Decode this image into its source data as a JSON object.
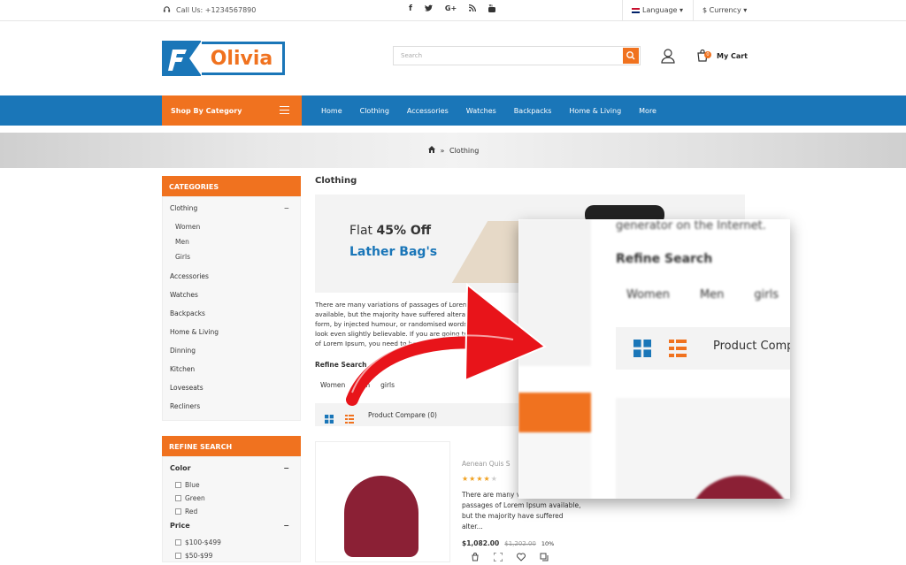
{
  "topbar": {
    "call": "Call Us: +1234567890",
    "language": "Language",
    "currency": "$ Currency",
    "social_icons": [
      "facebook-icon",
      "twitter-icon",
      "google-plus-icon",
      "rss-icon",
      "youtube-icon"
    ]
  },
  "header": {
    "logo_text": "Olivia",
    "search_placeholder": "Search",
    "cart_label": "My Cart",
    "cart_count": "0"
  },
  "nav": {
    "category_label": "Shop By Category",
    "items": [
      "Home",
      "Clothing",
      "Accessories",
      "Watches",
      "Backpacks",
      "Home & Living",
      "More"
    ]
  },
  "breadcrumb": {
    "current": "Clothing",
    "sep": "»"
  },
  "sidebar": {
    "categories_title": "CATEGORIES",
    "categories": [
      {
        "label": "Clothing",
        "toggle": "−"
      },
      {
        "label": "Accessories"
      },
      {
        "label": "Watches"
      },
      {
        "label": "Backpacks"
      },
      {
        "label": "Home & Living"
      },
      {
        "label": "Dinning"
      },
      {
        "label": "Kitchen"
      },
      {
        "label": "Loveseats"
      },
      {
        "label": "Recliners"
      }
    ],
    "subcategories": [
      "Women",
      "Men",
      "Girls"
    ],
    "refine_title": "REFINE SEARCH",
    "color_title": "Color",
    "colors": [
      "Blue",
      "Green",
      "Red"
    ],
    "price_title": "Price",
    "prices": [
      "$100-$499",
      "$50-$99"
    ]
  },
  "main": {
    "title": "Clothing",
    "promo_line1_prefix": "Flat ",
    "promo_line1_bold": "45% Off",
    "promo_line2": "Lather Bag's",
    "description": "There are many variations of passages of Lorem Ipsum available, but the majority have suffered alteration in some form, by injected humour, or randomised words which don't look even slightly believable. If you are going to use a passage of Lorem Ipsum, you need to be sure there isn't anything embarrassing hidden in the middle of text. All the Lorem Ipsum generators on the Internet tend to repeat predefined chunks as necessary, making this the first true generator on the Internet.",
    "refine_label": "Refine Search",
    "refine_tags": [
      "Women",
      "Men",
      "girls"
    ],
    "compare_label": "Product Compare (0)"
  },
  "product": {
    "name": "Aenean Quis S",
    "rating": 4,
    "max_rating": 5,
    "description": "There are many variations of passages of Lorem Ipsum available, but the majority have suffered alter...",
    "price": "$1,082.00",
    "old_price": "$1,202.00",
    "discount": "10%"
  },
  "zoom": {
    "top_text": "generator on the Internet.",
    "refine_label": "Refine Search",
    "tags": [
      "Women",
      "Men",
      "girls"
    ],
    "compare_label": "Product Compare (0)"
  },
  "colors": {
    "brand_blue": "#1a76b8",
    "brand_orange": "#f0721f",
    "arrow_red": "#e8141a"
  }
}
